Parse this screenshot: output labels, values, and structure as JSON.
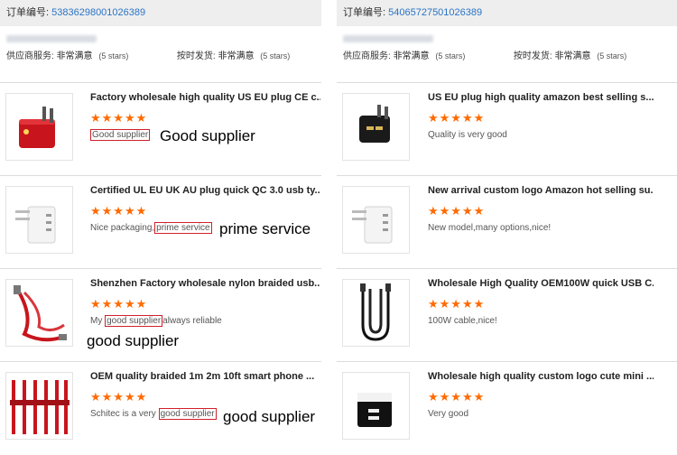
{
  "left": {
    "order_label": "订单编号:",
    "order_number": "53836298001026389",
    "supplier_label": "供应商服务:",
    "supplier_value": "非常满意",
    "supplier_stars": "(5 stars)",
    "ship_label": "按时发货:",
    "ship_value": "非常满意",
    "ship_stars": "(5 stars)",
    "items": [
      {
        "title": "Factory wholesale high quality US EU plug CE c...",
        "stars": "★★★★★",
        "pre": "",
        "hl": "Good supplier",
        "post": "",
        "annotation": "Good supplier",
        "product": "red-charger"
      },
      {
        "title": "Certified UL EU UK AU plug quick QC 3.0 usb ty...",
        "stars": "★★★★★",
        "pre": "Nice packaging,",
        "hl": "prime service",
        "post": "",
        "annotation": "prime service",
        "product": "white-charger"
      },
      {
        "title": "Shenzhen Factory wholesale nylon braided usb...",
        "stars": "★★★★★",
        "pre": "My ",
        "hl": "good supplier",
        "post": "always reliable",
        "annotation": "good supplier",
        "product": "red-cable"
      },
      {
        "title": "OEM quality braided 1m 2m 10ft smart phone ...",
        "stars": "★★★★★",
        "pre": "Schitec is a very ",
        "hl": "good supplier",
        "post": "",
        "annotation": "good supplier",
        "product": "red-cables"
      }
    ]
  },
  "right": {
    "order_label": "订单编号:",
    "order_number": "54065727501026389",
    "supplier_label": "供应商服务:",
    "supplier_value": "非常满意",
    "supplier_stars": "(5 stars)",
    "ship_label": "按时发货:",
    "ship_value": "非常满意",
    "ship_stars": "(5 stars)",
    "items": [
      {
        "title": "US EU plug high quality amazon best selling s...",
        "stars": "★★★★★",
        "comment": "Quality is very good",
        "product": "black-charger"
      },
      {
        "title": "New arrival custom logo Amazon hot selling su...",
        "stars": "★★★★★",
        "comment": "New model,many options,nice!",
        "product": "white-charger"
      },
      {
        "title": "Wholesale High Quality OEM100W quick USB C...",
        "stars": "★★★★★",
        "comment": "100W cable,nice!",
        "product": "black-cable"
      },
      {
        "title": "Wholesale high quality custom logo cute mini ...",
        "stars": "★★★★★",
        "comment": "Very good",
        "product": "cube-charger"
      }
    ]
  },
  "colors": {
    "link": "#2b74c6",
    "star": "#ff6a00",
    "highlight_border": "#d0202a"
  }
}
